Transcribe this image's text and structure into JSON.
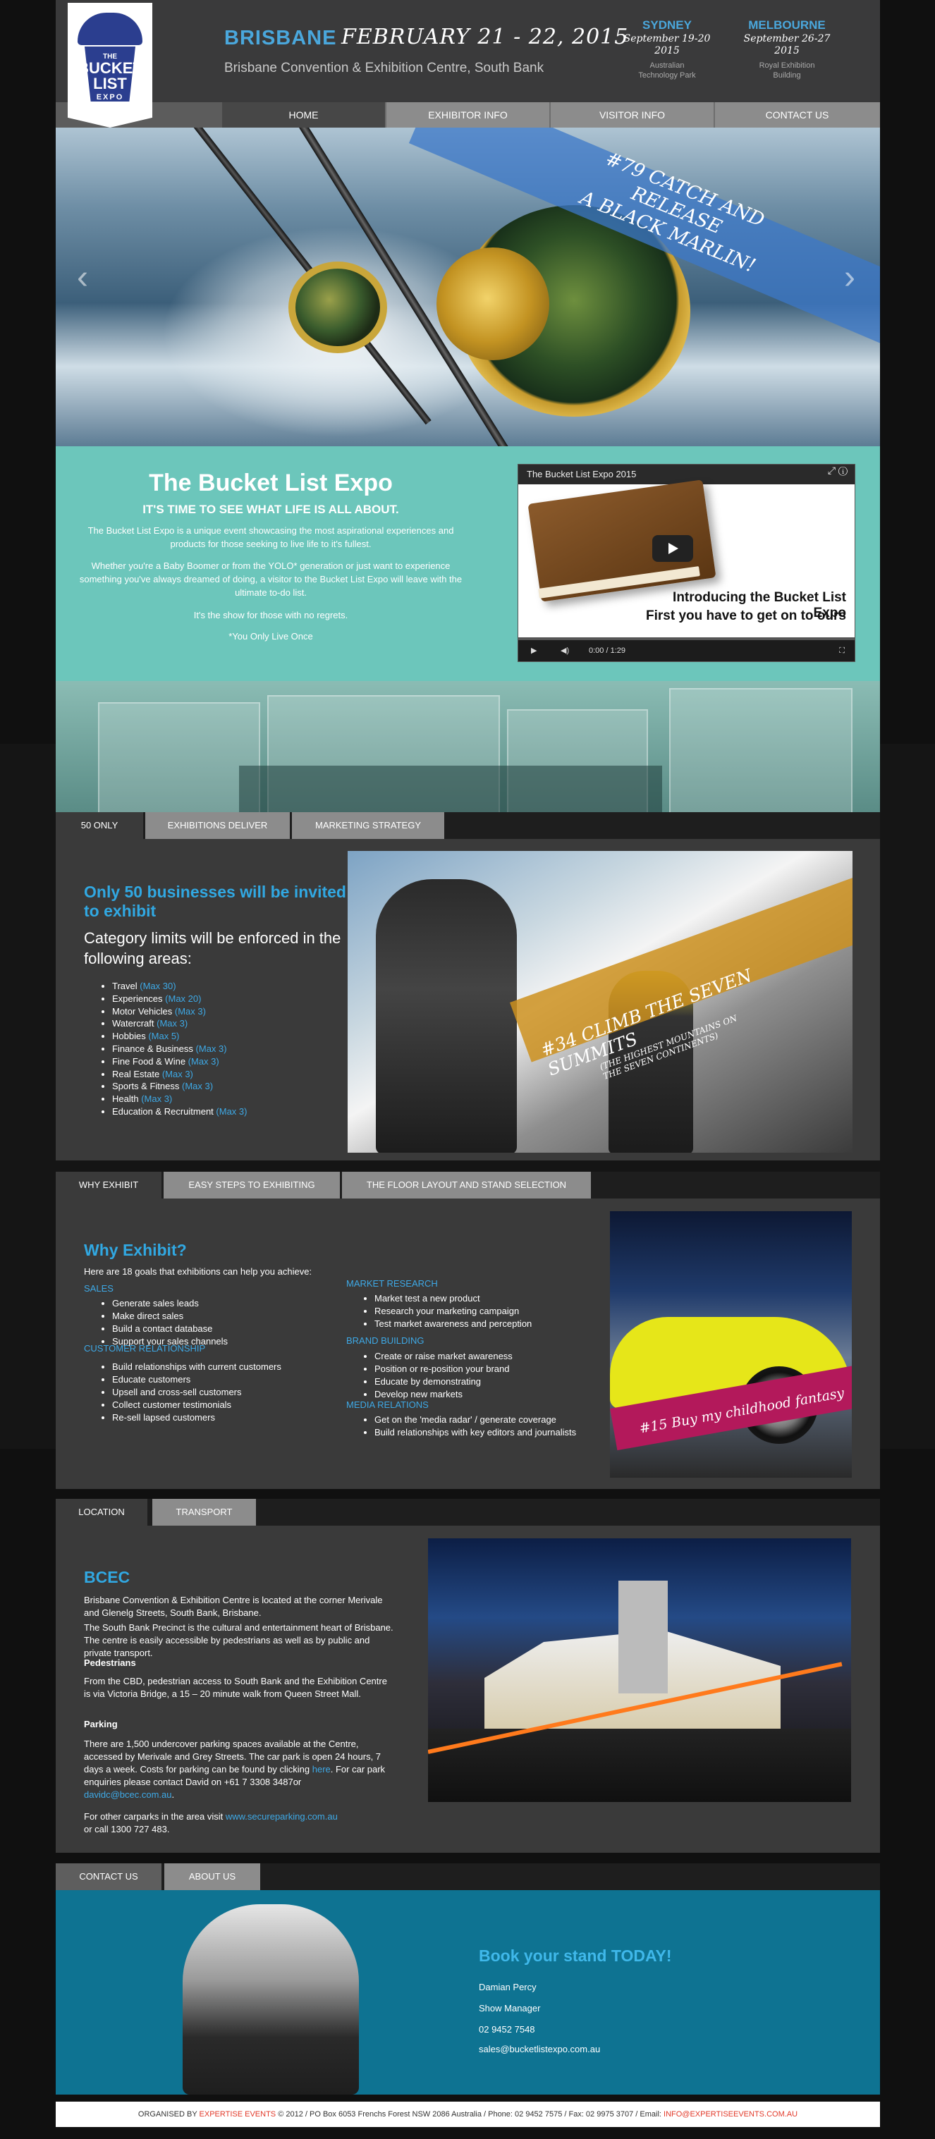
{
  "logo": {
    "line1": "THE",
    "line2": "BUCKET",
    "line3": "LIST",
    "line4": "EXPO"
  },
  "header": {
    "city": "BRISBANE",
    "date": "FEBRUARY 21 - 22, 2015",
    "venue": "Brisbane Convention & Exhibition Centre, South Bank",
    "events": [
      {
        "city": "SYDNEY",
        "date1": "September 19-20",
        "date2": "2015",
        "venue1": "Australian",
        "venue2": "Technology Park"
      },
      {
        "city": "MELBOURNE",
        "date1": "September 26-27",
        "date2": "2015",
        "venue1": "Royal Exhibition",
        "venue2": "Building"
      }
    ]
  },
  "nav": [
    "HOME",
    "EXHIBITOR INFO",
    "VISITOR INFO",
    "CONTACT US"
  ],
  "hero": {
    "caption1": "#79 CATCH AND RELEASE",
    "caption2": "A BLACK MARLIN!",
    "prev": "‹",
    "next": "›"
  },
  "intro": {
    "title": "The Bucket List Expo",
    "subtitle": "IT'S TIME TO SEE WHAT LIFE IS ALL ABOUT.",
    "p1": "The Bucket List Expo is a unique event showcasing the most aspirational experiences and products for those seeking to live life to it's fullest.",
    "p2": "Whether you're a Baby Boomer or from the YOLO* generation or just want to experience something you've always dreamed of doing, a visitor to the Bucket List Expo will leave with the ultimate to-do list.",
    "p3": "It's the show for those with no regrets.",
    "p4": "*You Only Live Once"
  },
  "video": {
    "title": "The Bucket List Expo 2015",
    "caption1": "Introducing the Bucket List Expo",
    "caption2": "First you have to get on to ours",
    "time": "0:00 / 1:29"
  },
  "tabs1": [
    "50 ONLY",
    "EXHIBITIONS DELIVER",
    "MARKETING STRATEGY"
  ],
  "only50": {
    "title": "Only 50 businesses will be invited to exhibit",
    "subtitle": "Category limits will be enforced in the following areas:",
    "categories": [
      {
        "name": "Travel",
        "max": "(Max 30)"
      },
      {
        "name": "Experiences",
        "max": "(Max 20)"
      },
      {
        "name": "Motor Vehicles",
        "max": "(Max 3)"
      },
      {
        "name": "Watercraft",
        "max": "(Max 3)"
      },
      {
        "name": "Hobbies",
        "max": "(Max 5)"
      },
      {
        "name": "Finance & Business",
        "max": "(Max 3)"
      },
      {
        "name": "Fine Food & Wine",
        "max": "(Max 3)"
      },
      {
        "name": "Real Estate",
        "max": "(Max 3)"
      },
      {
        "name": "Sports & Fitness",
        "max": "(Max 3)"
      },
      {
        "name": "Health",
        "max": "(Max 3)"
      },
      {
        "name": "Education & Recruitment",
        "max": "(Max 3)"
      }
    ],
    "photo_caption1": "#34 CLIMB THE SEVEN SUMMITS",
    "photo_caption2": "(THE HIGHEST MOUNTAINS ON",
    "photo_caption3": "THE SEVEN CONTINENTS)"
  },
  "tabs2": [
    "WHY EXHIBIT",
    "EASY STEPS TO EXHIBITING",
    "THE FLOOR LAYOUT AND STAND SELECTION"
  ],
  "why": {
    "title": "Why Exhibit?",
    "intro": "Here are 18 goals that exhibitions can help you achieve:",
    "sales_h": "SALES",
    "sales": [
      "Generate sales leads",
      "Make direct sales",
      "Build a contact database",
      "Support your sales channels"
    ],
    "cr_h": "CUSTOMER RELATIONSHIP",
    "cr": [
      "Build relationships with current customers",
      "Educate customers",
      "Upsell and cross-sell customers",
      "Collect customer testimonials",
      "Re-sell lapsed customers"
    ],
    "mr_h": "MARKET RESEARCH",
    "mr": [
      "Market test a new product",
      "Research your marketing campaign",
      "Test market awareness and perception"
    ],
    "bb_h": "BRAND BUILDING",
    "bb": [
      "Create or raise market awareness",
      "Position or re-position your brand",
      "Educate by demonstrating",
      "Develop new markets"
    ],
    "media_h": "MEDIA RELATIONS",
    "media": [
      "Get on the 'media radar' / generate coverage",
      "Build relationships with key editors and journalists"
    ],
    "photo_caption": "#15 Buy my childhood fantasy"
  },
  "tabs3": [
    "LOCATION",
    "TRANSPORT"
  ],
  "bcec": {
    "title": "BCEC",
    "p1": "Brisbane Convention & Exhibition Centre is located at the corner Merivale and Glenelg Streets, South Bank, Brisbane.",
    "p2": "The South Bank Precinct is the cultural and entertainment heart of Brisbane. The centre is easily accessible by pedestrians as well as by public and private transport.",
    "ped_h": "Pedestrians",
    "p3": "From the CBD, pedestrian access to South Bank and the Exhibition Centre is via Victoria Bridge, a 15 – 20 minute walk from Queen Street Mall.",
    "park_h": "Parking",
    "p4a": "There are 1,500 undercover parking spaces available at the Centre, accessed by Merivale and Grey Streets.  The car park is open 24 hours, 7 days a week. Costs for parking can be found by clicking ",
    "p4link": "here",
    "p4b": ". For car park enquiries please contact David on +61 7 3308 3487or",
    "p4email": "davidc@bcec.com.au",
    "p4c": ".",
    "p5a": "For other carparks in the area visit ",
    "p5link": "www.secureparking.com.au",
    "p5b": "or call 1300 727 483."
  },
  "tabs4": [
    "CONTACT US",
    "ABOUT US"
  ],
  "contact": {
    "title": "Book your stand TODAY!",
    "name": "Damian Percy",
    "role": "Show Manager",
    "phone": "02 9452 7548",
    "email": "sales@bucketlistexpo.com.au"
  },
  "footer": {
    "pre": "ORGANISED BY ",
    "org": "EXPERTISE EVENTS",
    "mid": " © 2012 / PO Box 6053 Frenchs Forest NSW 2086 Australia / Phone: 02 9452 7575 / Fax: 02 9975 3707 / Email: ",
    "email": "INFO@EXPERTISEEVENTS.COM.AU"
  }
}
